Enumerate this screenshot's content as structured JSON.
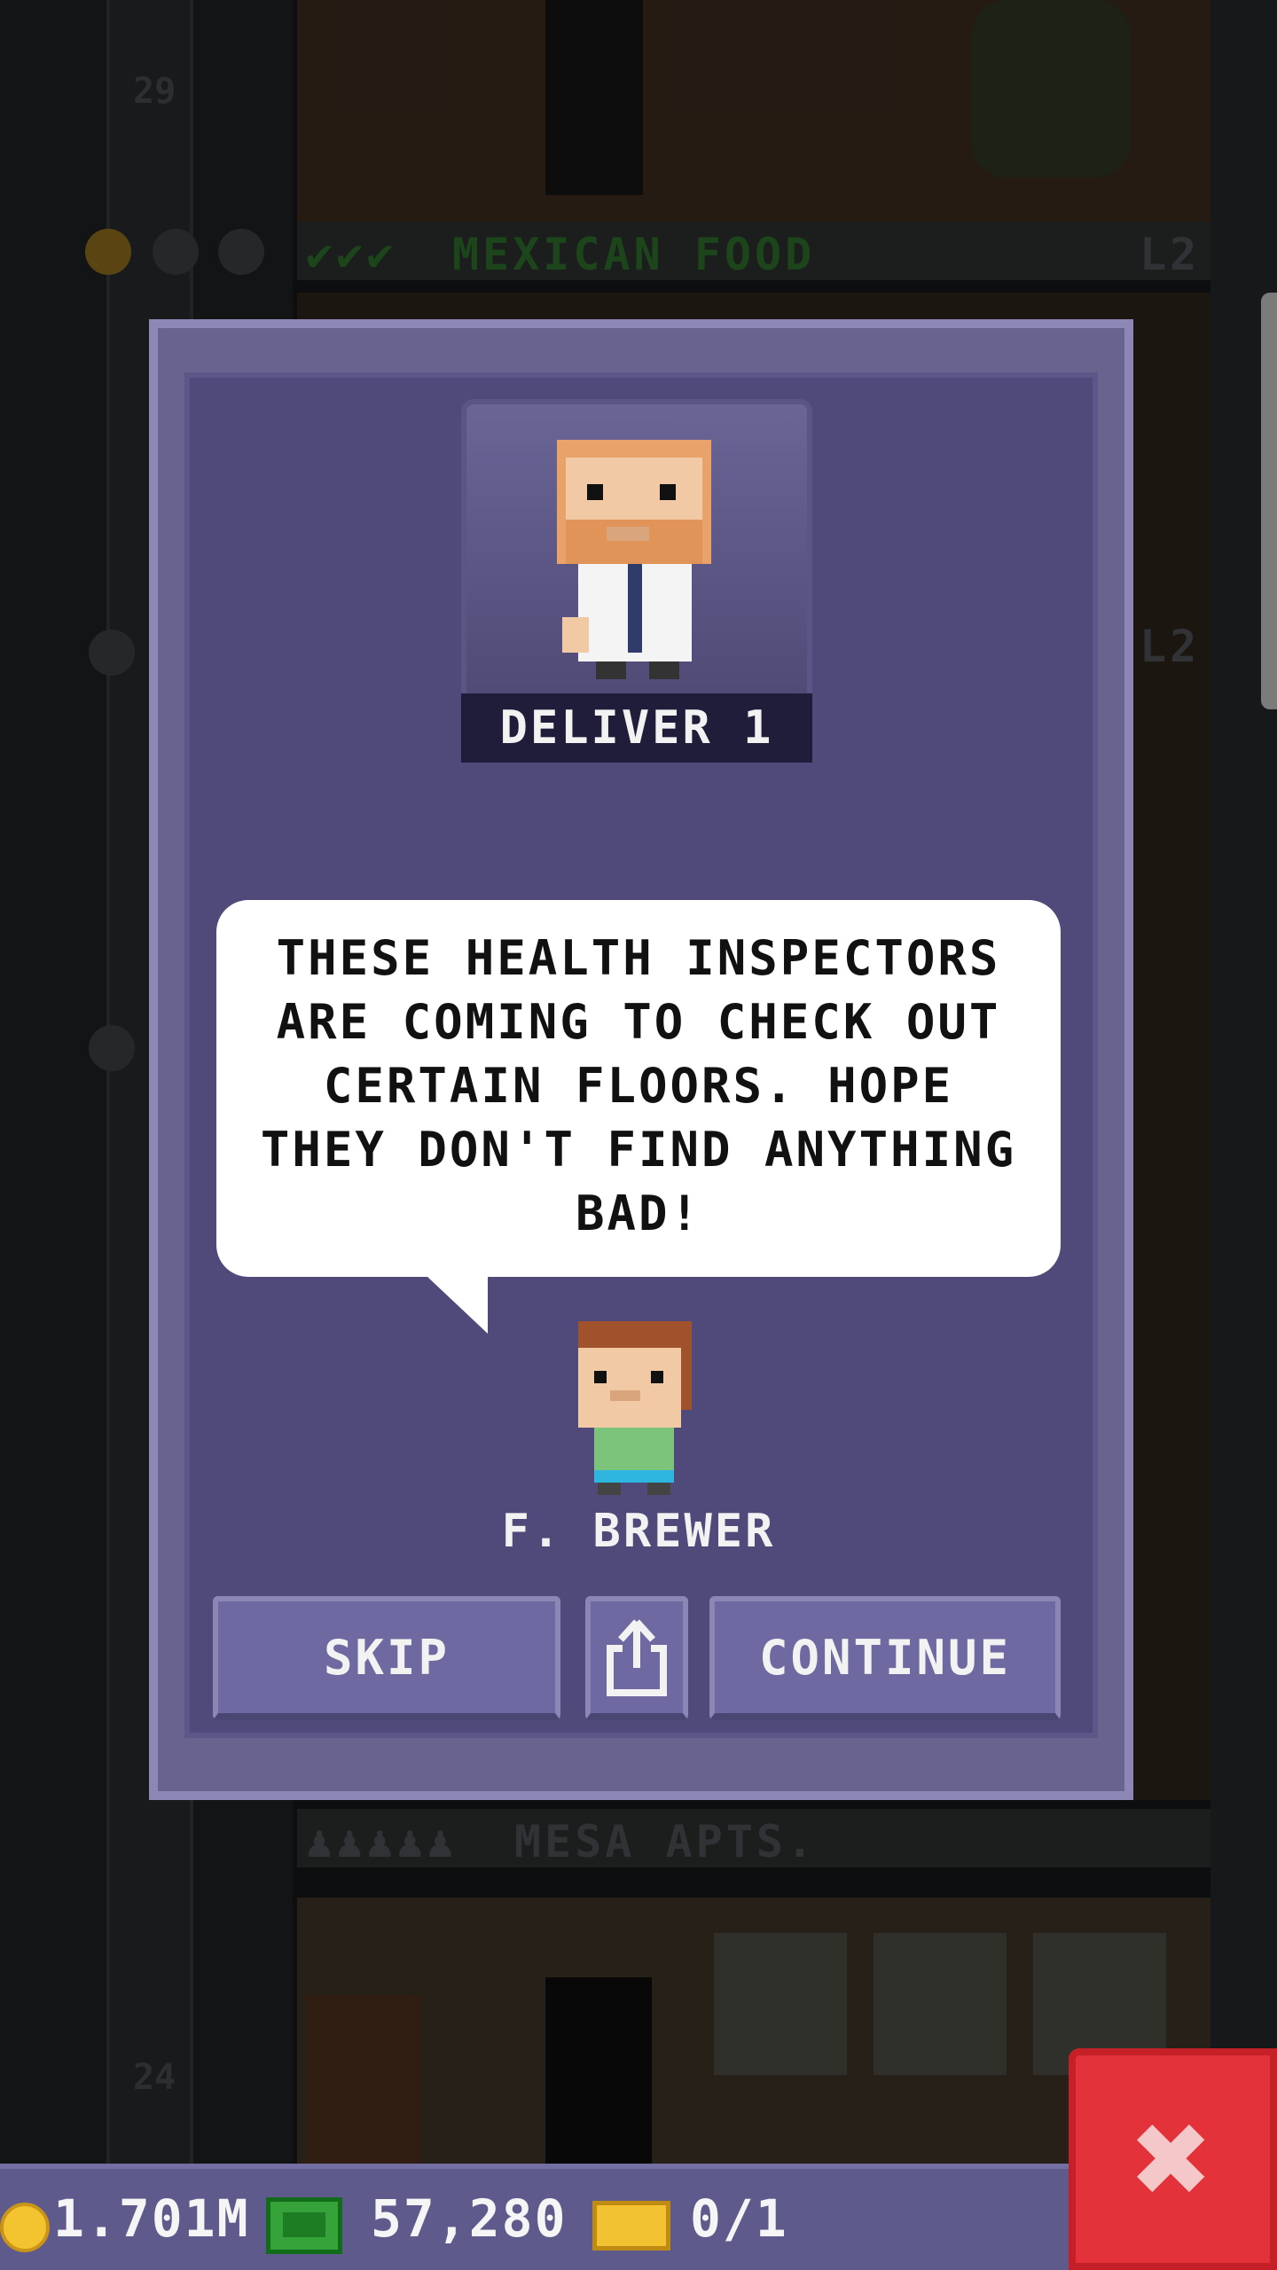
{
  "background": {
    "floor_numbers": [
      "29",
      "24"
    ],
    "floor_labels": [
      {
        "text": "MEXICAN FOOD",
        "color": "#2c6b2a"
      },
      {
        "text": "MESA APTS.",
        "color": "#4a4d52"
      }
    ],
    "level_tags": [
      "L2",
      "L2"
    ],
    "check_marks": "✔✔✔",
    "residents_icon": "♟♟♟♟♟"
  },
  "dialog": {
    "mission_label": "DELIVER 1",
    "message": "THESE HEALTH INSPECTORS ARE COMING TO CHECK OUT CERTAIN FLOORS. HOPE THEY DON'T FIND ANYTHING BAD!",
    "speaker_name": "F. BREWER",
    "buttons": {
      "skip": "SKIP",
      "continue": "CONTINUE",
      "share_icon": "share-icon"
    }
  },
  "status_bar": {
    "coins": "1.701M",
    "bux": "57,280",
    "tickets": "0/1"
  },
  "close_button": "✖",
  "colors": {
    "dialog_bg": "#4f4a7a",
    "button_bg": "#6e69a0",
    "close_red": "#e3323a",
    "coin_gold": "#f3c330",
    "cash_green": "#35a23a"
  }
}
